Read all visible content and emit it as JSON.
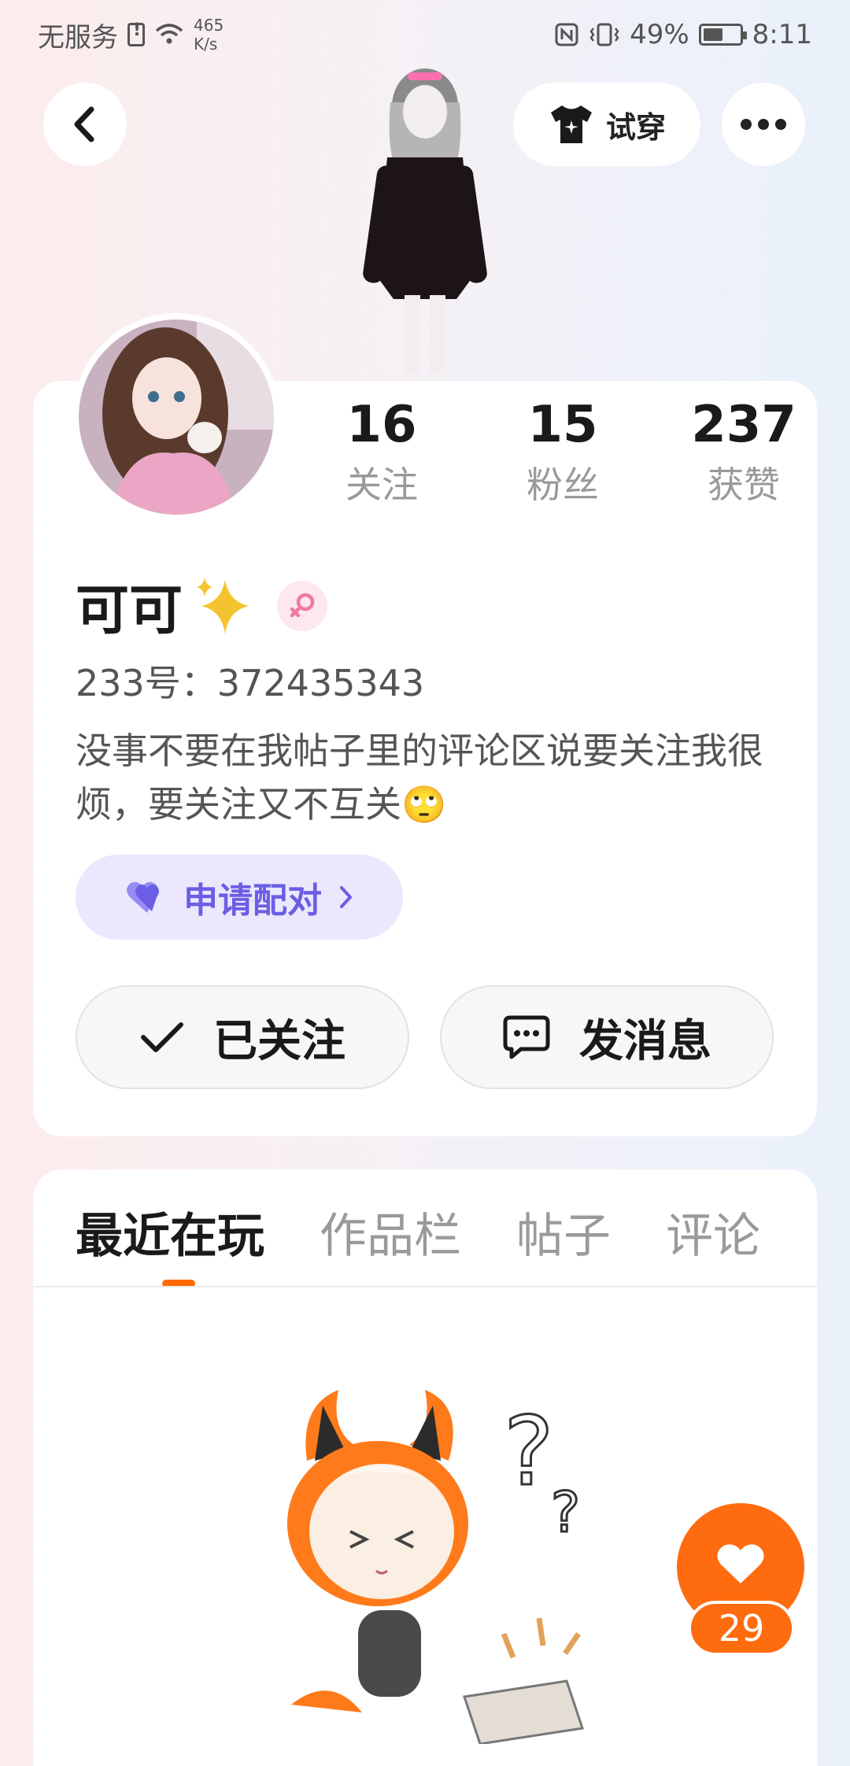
{
  "status_bar": {
    "carrier": "无服务",
    "net_speed_value": "465",
    "net_speed_unit": "K/s",
    "battery": "49%",
    "time": "8:11"
  },
  "header": {
    "try_on_label": "试穿"
  },
  "profile": {
    "stats": [
      {
        "value": "16",
        "label": "关注"
      },
      {
        "value": "15",
        "label": "粉丝"
      },
      {
        "value": "237",
        "label": "获赞"
      }
    ],
    "name": "可可",
    "name_emoji": "✨",
    "uid": "233号：372435343",
    "bio": "没事不要在我帖子里的评论区说要关注我很烦，要关注又不互关🙄",
    "pair_label": "申请配对",
    "followed_label": "已关注",
    "message_label": "发消息"
  },
  "tabs": [
    {
      "label": "最近在玩",
      "active": true
    },
    {
      "label": "作品栏",
      "active": false
    },
    {
      "label": "帖子",
      "active": false
    },
    {
      "label": "评论",
      "active": false
    }
  ],
  "like_count": "29",
  "colors": {
    "accent_orange": "#ff6b0f",
    "pair_purple": "#6b5ee4",
    "pair_bg": "#ebe8fd",
    "female_pink": "#f07aa0"
  }
}
